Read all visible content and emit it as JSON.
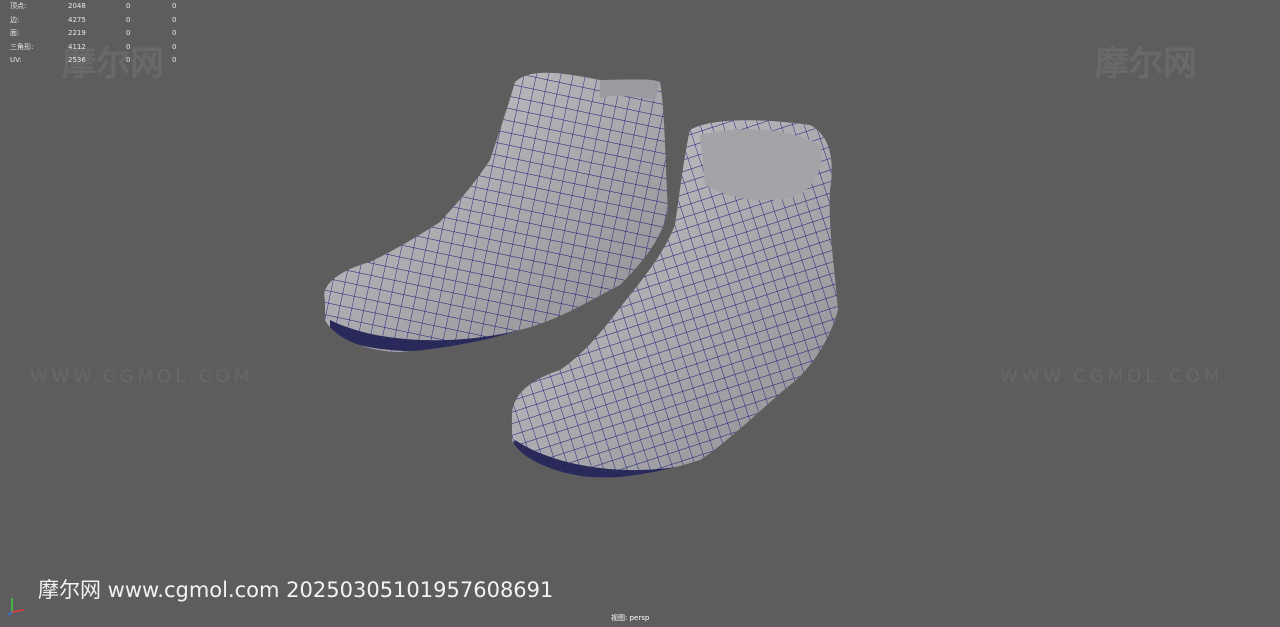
{
  "hud": {
    "rows": [
      {
        "label": "顶点:",
        "v1": "2048",
        "v2": "0",
        "v3": "0"
      },
      {
        "label": "边:",
        "v1": "4275",
        "v2": "0",
        "v3": "0"
      },
      {
        "label": "面:",
        "v1": "2219",
        "v2": "0",
        "v3": "0"
      },
      {
        "label": "三角形:",
        "v1": "4112",
        "v2": "0",
        "v3": "0"
      },
      {
        "label": "UV:",
        "v1": "2536",
        "v2": "0",
        "v3": "0"
      }
    ]
  },
  "camera_label": "视图: persp",
  "watermark_text": "摩尔网 www.cgmol.com 20250305101957608691",
  "faint_logo": "摩尔网",
  "faint_url": "WWW.CGMOL.COM",
  "colors": {
    "background": "#5d5d5d",
    "wire": "#1a1a7a",
    "mesh": "#b9b9bd"
  }
}
